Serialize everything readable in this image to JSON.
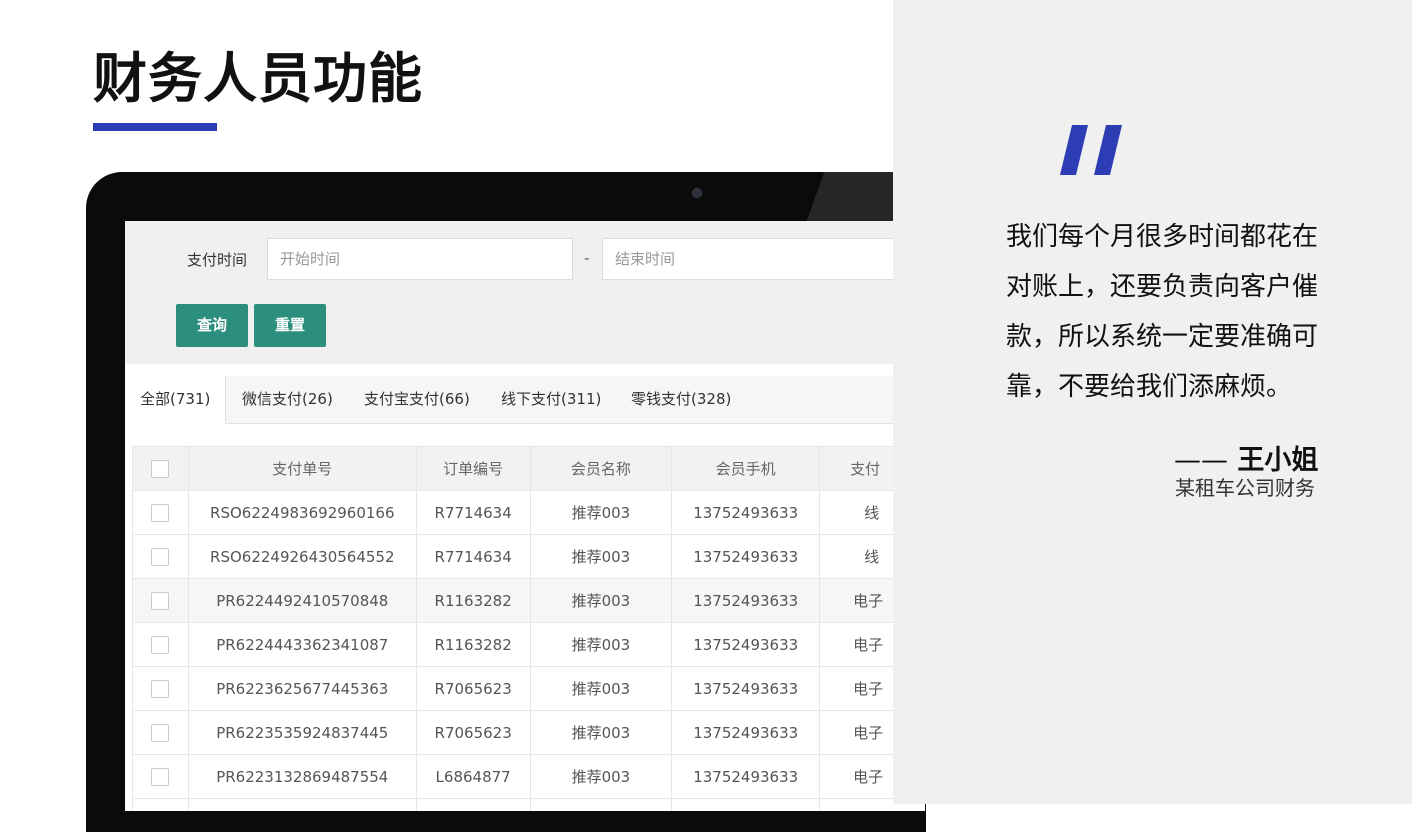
{
  "slide": {
    "title": "财务人员功能",
    "accent_color": "#2d3db3"
  },
  "filter": {
    "label": "支付时间",
    "start_placeholder": "开始时间",
    "separator": "-",
    "end_placeholder": "结束时间",
    "query_button": "查询",
    "reset_button": "重置",
    "button_color": "#2c8f7d"
  },
  "tabs": [
    {
      "label": "全部(731)",
      "active": true
    },
    {
      "label": "微信支付(26)",
      "active": false
    },
    {
      "label": "支付宝支付(66)",
      "active": false
    },
    {
      "label": "线下支付(311)",
      "active": false
    },
    {
      "label": "零钱支付(328)",
      "active": false
    }
  ],
  "table": {
    "headers": [
      "支付单号",
      "订单编号",
      "会员名称",
      "会员手机",
      "支付"
    ],
    "rows": [
      {
        "pay_no": "RSO6224983692960166",
        "order_no": "R7714634",
        "member": "推荐003",
        "phone": "13752493633",
        "pay_type": "线"
      },
      {
        "pay_no": "RSO6224926430564552",
        "order_no": "R7714634",
        "member": "推荐003",
        "phone": "13752493633",
        "pay_type": "线"
      },
      {
        "pay_no": "PR6224492410570848",
        "order_no": "R1163282",
        "member": "推荐003",
        "phone": "13752493633",
        "pay_type": "电子"
      },
      {
        "pay_no": "PR6224443362341087",
        "order_no": "R1163282",
        "member": "推荐003",
        "phone": "13752493633",
        "pay_type": "电子"
      },
      {
        "pay_no": "PR6223625677445363",
        "order_no": "R7065623",
        "member": "推荐003",
        "phone": "13752493633",
        "pay_type": "电子"
      },
      {
        "pay_no": "PR6223535924837445",
        "order_no": "R7065623",
        "member": "推荐003",
        "phone": "13752493633",
        "pay_type": "电子"
      },
      {
        "pay_no": "PR6223132869487554",
        "order_no": "L6864877",
        "member": "推荐003",
        "phone": "13752493633",
        "pay_type": "电子"
      }
    ]
  },
  "quote": {
    "text": "我们每个月很多时间都花在对账上，还要负责向客户催款，所以系统一定要准确可靠，不要给我们添麻烦。",
    "author_dash": "——",
    "author": "王小姐",
    "role": "某租车公司财务",
    "mark_color": "#2d3db3"
  }
}
